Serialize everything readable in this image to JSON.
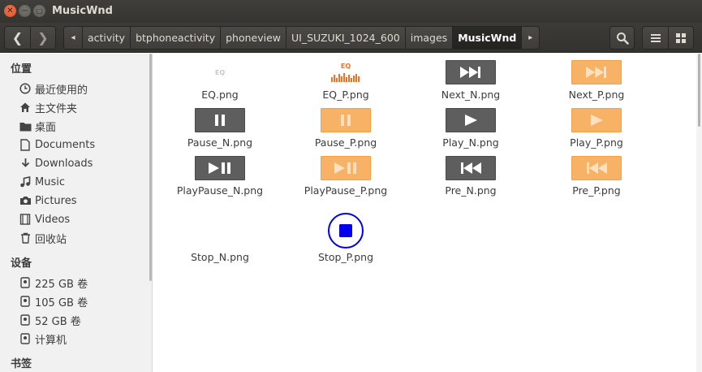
{
  "window": {
    "title": "MusicWnd"
  },
  "toolbar": {
    "breadcrumbs": [
      "activity",
      "btphoneactivity",
      "phoneview",
      "UI_SUZUKI_1024_600",
      "images",
      "MusicWnd"
    ]
  },
  "sidebar": {
    "sections": [
      {
        "title": "位置"
      },
      {
        "title": "设备"
      },
      {
        "title": "书签"
      }
    ],
    "places": [
      {
        "label": "最近使用的",
        "icon": "clock-icon"
      },
      {
        "label": "主文件夹",
        "icon": "home-icon"
      },
      {
        "label": "桌面",
        "icon": "folder-icon"
      },
      {
        "label": "Documents",
        "icon": "document-icon"
      },
      {
        "label": "Downloads",
        "icon": "download-icon"
      },
      {
        "label": "Music",
        "icon": "music-icon"
      },
      {
        "label": "Pictures",
        "icon": "camera-icon"
      },
      {
        "label": "Videos",
        "icon": "film-icon"
      },
      {
        "label": "回收站",
        "icon": "trash-icon"
      }
    ],
    "devices": [
      {
        "label": "225 GB 卷",
        "icon": "drive-icon"
      },
      {
        "label": "105 GB 卷",
        "icon": "drive-icon"
      },
      {
        "label": "52 GB 卷",
        "icon": "drive-icon"
      },
      {
        "label": "计算机",
        "icon": "drive-icon"
      }
    ]
  },
  "files": [
    {
      "name": "EQ.png",
      "thumb": "eq-normal",
      "thumb_text": "EQ"
    },
    {
      "name": "EQ_P.png",
      "thumb": "eq-pressed",
      "thumb_text": "EQ"
    },
    {
      "name": "Next_N.png",
      "thumb": "next-icon"
    },
    {
      "name": "Next_P.png",
      "thumb": "next-icon"
    },
    {
      "name": "Pause_N.png",
      "thumb": "pause-icon"
    },
    {
      "name": "Pause_P.png",
      "thumb": "pause-icon"
    },
    {
      "name": "Play_N.png",
      "thumb": "play-icon"
    },
    {
      "name": "Play_P.png",
      "thumb": "play-icon"
    },
    {
      "name": "PlayPause_N.png",
      "thumb": "play-pause-icon"
    },
    {
      "name": "PlayPause_P.png",
      "thumb": "play-pause-icon"
    },
    {
      "name": "Pre_N.png",
      "thumb": "previous-icon"
    },
    {
      "name": "Pre_P.png",
      "thumb": "previous-icon"
    },
    {
      "name": "Stop_N.png",
      "thumb": "blank"
    },
    {
      "name": "Stop_P.png",
      "thumb": "stop-icon"
    }
  ],
  "colors": {
    "normal_button": "#5e5e5e",
    "pressed_button": "#f8b265",
    "eq_orange": "#e8742a",
    "stop_blue": "#0000ee",
    "titlebar": "#3c3b37"
  }
}
